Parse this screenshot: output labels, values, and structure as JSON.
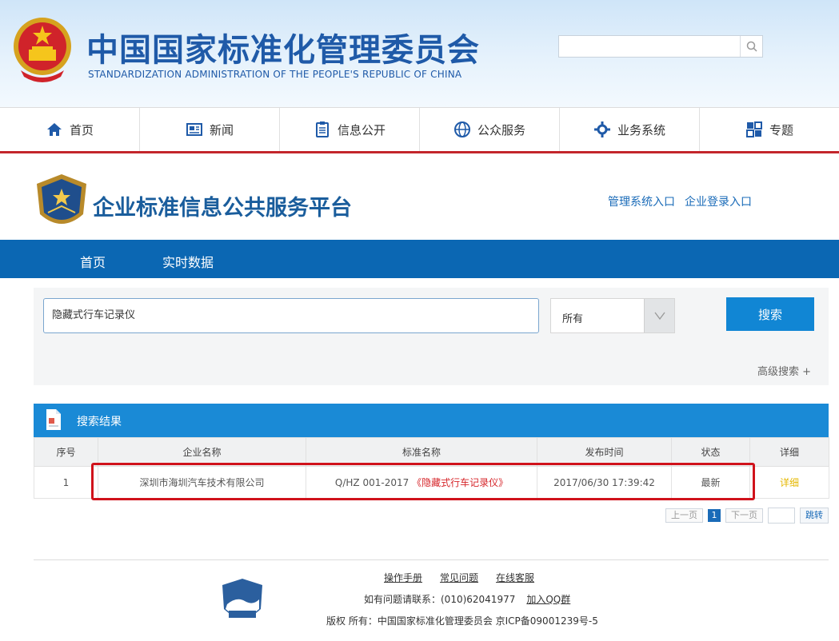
{
  "site": {
    "org_name_cn": "中国国家标准化管理委员会",
    "org_name_en": "STANDARDIZATION ADMINISTRATION OF THE PEOPLE'S REPUBLIC OF CHINA",
    "search_value": ""
  },
  "main_nav": [
    {
      "label": "首页",
      "icon": "home-icon"
    },
    {
      "label": "新闻",
      "icon": "news-icon"
    },
    {
      "label": "信息公开",
      "icon": "clipboard-icon"
    },
    {
      "label": "公众服务",
      "icon": "globe-icon"
    },
    {
      "label": "业务系统",
      "icon": "gear-icon"
    },
    {
      "label": "专题",
      "icon": "topic-icon"
    }
  ],
  "platform": {
    "title": "企业标准信息公共服务平台",
    "admin_link": "管理系统入口",
    "login_link": "企业登录入口"
  },
  "sub_nav": {
    "home": "首页",
    "realtime": "实时数据"
  },
  "search": {
    "keyword": "隐藏式行车记录仪",
    "scope": "所有",
    "button": "搜索",
    "advanced": "高级搜索 +"
  },
  "results": {
    "title": "搜索结果",
    "columns": [
      "序号",
      "企业名称",
      "标准名称",
      "发布时间",
      "状态",
      "详细"
    ],
    "rows": [
      {
        "no": "1",
        "company": "深圳市海圳汽车技术有限公司",
        "std_code": "Q/HZ 001-2017",
        "std_name": "《隐藏式行车记录仪》",
        "date": "2017/06/30 17:39:42",
        "status": "最新",
        "detail": "详细"
      }
    ]
  },
  "pager": {
    "prev": "上一页",
    "current": "1",
    "next": "下一页",
    "go": "跳转"
  },
  "footer": {
    "manual": "操作手册",
    "faq": "常见问题",
    "support": "在线客服",
    "contact": "如有问题请联系：(010)62041977",
    "qq": "加入QQ群",
    "copyright": "版权 所有：中国国家标准化管理委员会   京ICP备09001239号-5"
  },
  "colors": {
    "brand_blue": "#1f5aa8",
    "nav_red": "#c3262b",
    "subnav_blue": "#0b67b3",
    "button_blue": "#1186d4",
    "highlight_red": "#d6252a"
  }
}
